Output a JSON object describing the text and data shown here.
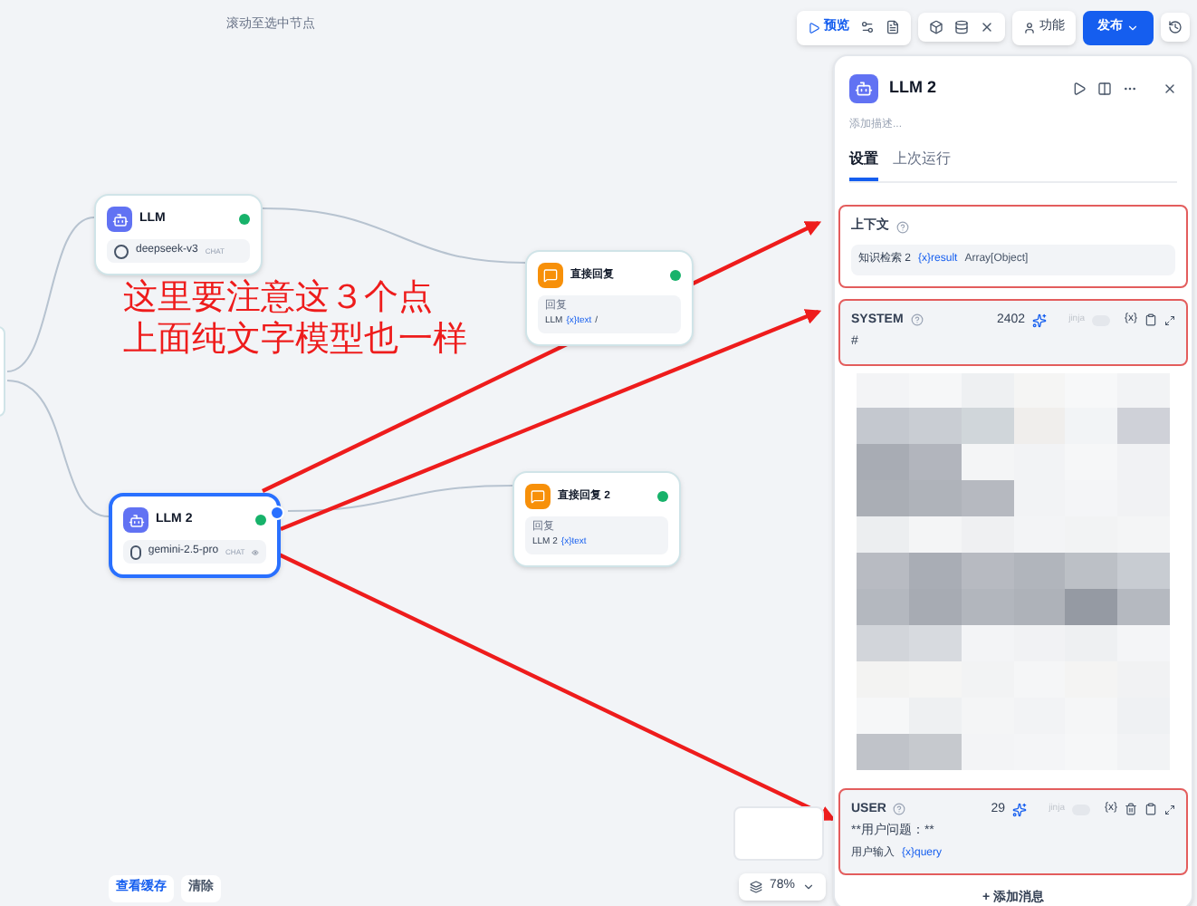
{
  "canvas": {
    "hint": "滚动至选中节点",
    "nodes": [
      {
        "kind": "llm",
        "title": "LLM",
        "model": "deepseek-v3",
        "badge": "CHAT",
        "selected": false
      },
      {
        "kind": "answer",
        "title": "直接回复",
        "field_label": "回复",
        "ref_node": "LLM",
        "ref_var": "{x}text",
        "ref_suffix": "/"
      },
      {
        "kind": "llm",
        "title": "LLM 2",
        "model": "gemini-2.5-pro",
        "badge": "CHAT",
        "selected": true
      },
      {
        "kind": "answer",
        "title": "直接回复 2",
        "field_label": "回复",
        "ref_node": "LLM 2",
        "ref_var": "{x}text"
      }
    ],
    "annotation": [
      "这里要注意这３个点",
      "上面纯文字模型也一样"
    ],
    "bottom_buttons": [
      {
        "label": "查看缓存",
        "primary": true
      },
      {
        "label": "清除",
        "primary": false
      }
    ],
    "zoom": "78%"
  },
  "toolbar": {
    "preview": "预览",
    "features": "功能",
    "publish": "发布"
  },
  "panel": {
    "title": "LLM 2",
    "description_placeholder": "添加描述...",
    "tabs": [
      {
        "label": "设置",
        "selected": true
      },
      {
        "label": "上次运行",
        "selected": false
      }
    ],
    "context": {
      "label": "上下文",
      "source": "知识检索 2",
      "var": "{x}result",
      "type": "Array[Object]"
    },
    "messages": [
      {
        "role": "SYSTEM",
        "count": "2402",
        "jinja": "jinja",
        "jinja_on": false,
        "var_button": "{x}",
        "lines": [
          "#"
        ]
      },
      {
        "role": "USER",
        "count": "29",
        "jinja": "jinja",
        "jinja_on": false,
        "var_button": "{x}",
        "lines": [
          "**用户问题：**"
        ],
        "ref_node": "用户输入",
        "ref_var": "{x}query"
      }
    ],
    "add_message": "+ 添加消息"
  }
}
